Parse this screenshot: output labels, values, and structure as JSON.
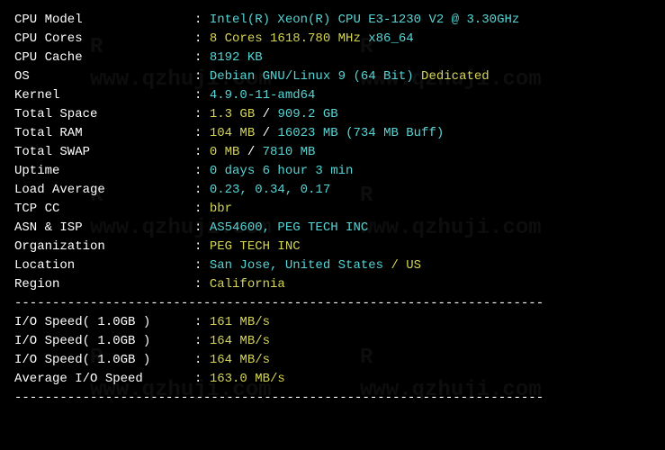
{
  "info": [
    {
      "label": "CPU Model",
      "value": "Intel(R) Xeon(R) CPU E3-1230 V2 @ 3.30GHz",
      "color": "cyan"
    },
    {
      "label": "CPU Cores",
      "parts": [
        {
          "text": "8 Cores 1618.780 MHz",
          "color": "yellow"
        },
        {
          "text": " x86_64",
          "color": "cyan"
        }
      ]
    },
    {
      "label": "CPU Cache",
      "value": "8192 KB",
      "color": "cyan"
    },
    {
      "label": "OS",
      "parts": [
        {
          "text": "Debian GNU/Linux 9 (64 Bit)",
          "color": "cyan"
        },
        {
          "text": " Dedicated",
          "color": "yellow"
        }
      ]
    },
    {
      "label": "Kernel",
      "value": "4.9.0-11-amd64",
      "color": "cyan"
    },
    {
      "label": "Total Space",
      "parts": [
        {
          "text": "1.3 GB",
          "color": "yellow"
        },
        {
          "text": " / ",
          "color": "white"
        },
        {
          "text": "909.2 GB",
          "color": "cyan"
        }
      ]
    },
    {
      "label": "Total RAM",
      "parts": [
        {
          "text": "104 MB",
          "color": "yellow"
        },
        {
          "text": " / ",
          "color": "white"
        },
        {
          "text": "16023 MB",
          "color": "cyan"
        },
        {
          "text": " (734 MB Buff)",
          "color": "cyan"
        }
      ]
    },
    {
      "label": "Total SWAP",
      "parts": [
        {
          "text": "0 MB",
          "color": "yellow"
        },
        {
          "text": " / ",
          "color": "white"
        },
        {
          "text": "7810 MB",
          "color": "cyan"
        }
      ]
    },
    {
      "label": "Uptime",
      "value": "0 days 6 hour 3 min",
      "color": "cyan"
    },
    {
      "label": "Load Average",
      "value": "0.23, 0.34, 0.17",
      "color": "cyan"
    },
    {
      "label": "TCP CC",
      "value": "bbr",
      "color": "yellow"
    },
    {
      "label": "ASN & ISP",
      "value": "AS54600, PEG TECH INC",
      "color": "cyan"
    },
    {
      "label": "Organization",
      "value": "PEG TECH INC",
      "color": "yellow"
    },
    {
      "label": "Location",
      "parts": [
        {
          "text": "San Jose, United States",
          "color": "cyan"
        },
        {
          "text": " / US",
          "color": "yellow"
        }
      ]
    },
    {
      "label": "Region",
      "value": "California",
      "color": "yellow"
    }
  ],
  "io": [
    {
      "label": "I/O Speed( 1.0GB )",
      "value": "161 MB/s",
      "color": "yellow"
    },
    {
      "label": "I/O Speed( 1.0GB )",
      "value": "164 MB/s",
      "color": "yellow"
    },
    {
      "label": "I/O Speed( 1.0GB )",
      "value": "164 MB/s",
      "color": "yellow"
    },
    {
      "label": "Average I/O Speed",
      "value": "163.0 MB/s",
      "color": "yellow"
    }
  ],
  "divider": "----------------------------------------------------------------------",
  "watermark": "www.qzhuji.com"
}
